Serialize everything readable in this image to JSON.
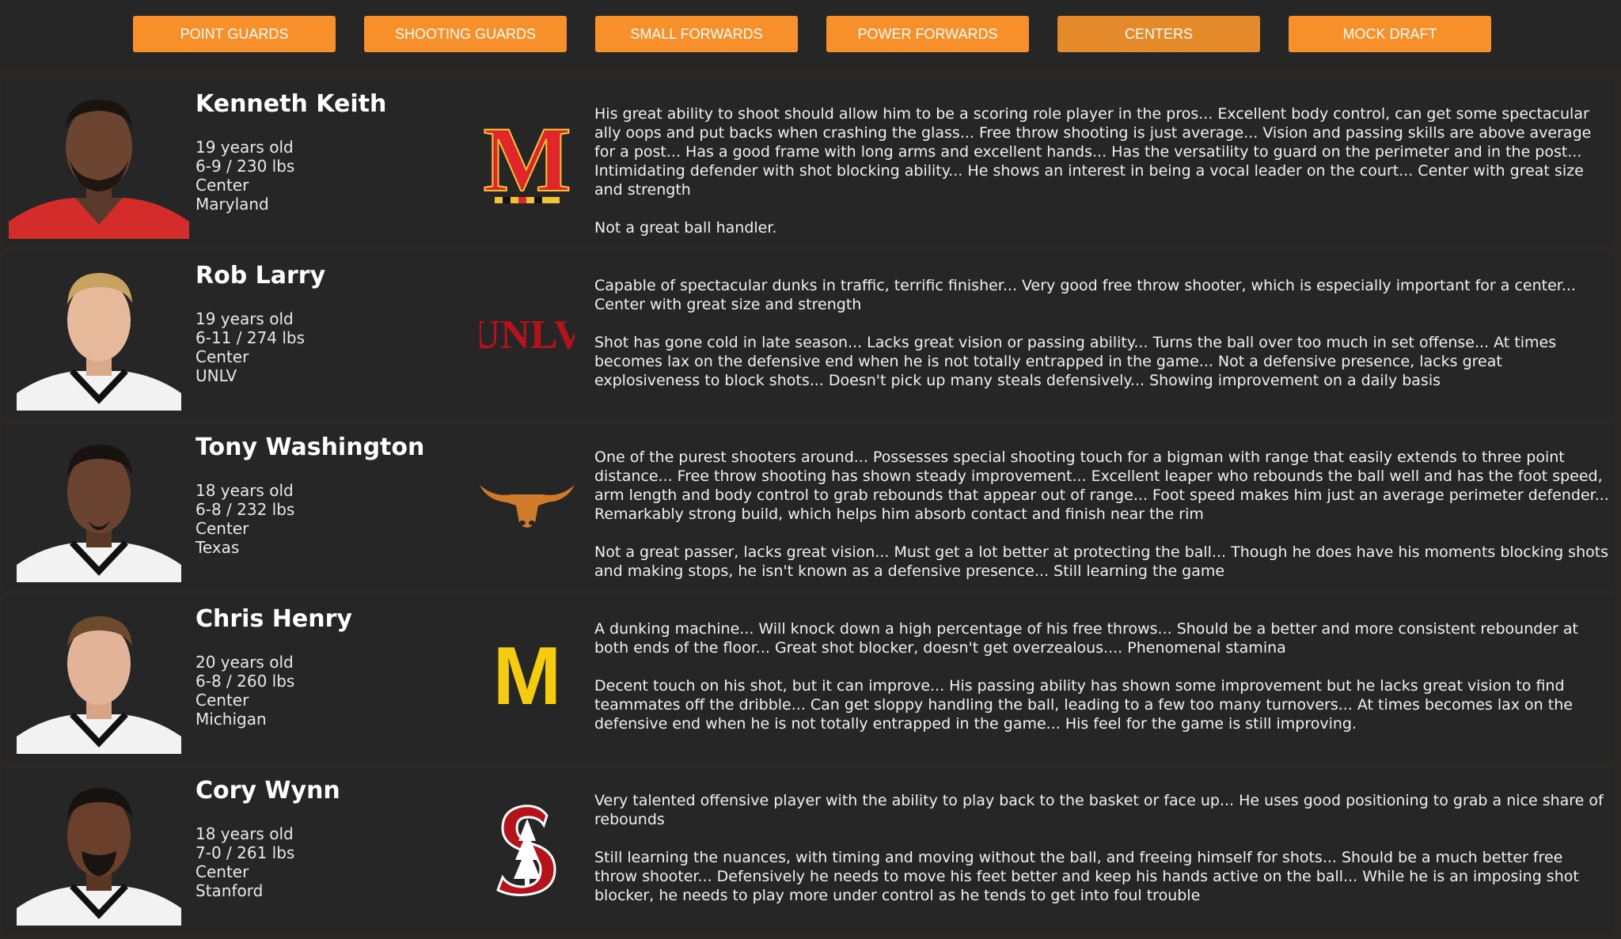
{
  "tabs": [
    {
      "label": "POINT GUARDS"
    },
    {
      "label": "SHOOTING GUARDS"
    },
    {
      "label": "SMALL FORWARDS"
    },
    {
      "label": "POWER FORWARDS"
    },
    {
      "label": "CENTERS"
    },
    {
      "label": "MOCK DRAFT"
    }
  ],
  "prospects": [
    {
      "name": "Kenneth Keith",
      "age": "19 years old",
      "size": "6-9 / 230 lbs",
      "position": "Center",
      "school": "Maryland",
      "logo_text": "M",
      "strengths": "His great ability to shoot should allow him to be a scoring role player in the pros... Excellent body control, can get some spectacular ally oops and put backs when crashing the glass... Free throw shooting is just average... Vision and passing skills are above average for a post... Has a good frame with long arms and excellent hands... Has the versatility to guard on the perimeter and in the post... Intimidating defender with shot blocking ability... He shows an interest in being a vocal leader on the court... Center with great size and strength",
      "weaknesses": "Not a great ball handler."
    },
    {
      "name": "Rob Larry",
      "age": "19 years old",
      "size": "6-11 / 274 lbs",
      "position": "Center",
      "school": "UNLV",
      "logo_text": "UNLV",
      "strengths": "Capable of spectacular dunks in traffic, terrific finisher... Very good free throw shooter, which is especially important for a center... Center with great size and strength",
      "weaknesses": "Shot has gone cold in late season... Lacks great vision or passing ability... Turns the ball over too much in set offense... At times becomes lax on the defensive end when he is not totally entrapped in the game... Not a defensive presence, lacks great explosiveness to block shots... Doesn't pick up many steals defensively... Showing improvement on a daily basis"
    },
    {
      "name": "Tony Washington",
      "age": "18 years old",
      "size": "6-8 / 232 lbs",
      "position": "Center",
      "school": "Texas",
      "logo_text": "",
      "strengths": "One of the purest shooters around... Possesses special shooting touch for a bigman with range that easily extends to three point distance... Free throw shooting has shown steady improvement... Excellent leaper who rebounds the ball well and has the foot speed, arm length and body control to grab rebounds that appear out of range... Foot speed makes him just an average perimeter defender... Remarkably strong build, which helps him absorb contact and finish near the rim",
      "weaknesses": "Not a great passer, lacks great vision... Must get a lot better at protecting the ball... Though he does have his moments blocking shots and making stops, he isn't known as a defensive presence... Still learning the game"
    },
    {
      "name": "Chris Henry",
      "age": "20 years old",
      "size": "6-8 / 260 lbs",
      "position": "Center",
      "school": "Michigan",
      "logo_text": "M",
      "strengths": "A dunking machine... Will knock down a high percentage of his free throws... Should be a better and more consistent rebounder at both ends of the floor... Great shot blocker, doesn't get overzealous.... Phenomenal stamina",
      "weaknesses": "Decent touch on his shot, but it can improve... His passing ability has shown some improvement but he lacks great vision to find teammates off the dribble... Can get sloppy handling the ball, leading to a few too many turnovers... At times becomes lax on the defensive end when he is not totally entrapped in the game... His feel for the game is still improving."
    },
    {
      "name": "Cory Wynn",
      "age": "18 years old",
      "size": "7-0 / 261 lbs",
      "position": "Center",
      "school": "Stanford",
      "logo_text": "",
      "strengths": "Very talented offensive player with the ability to play back to the basket or face up... He uses good positioning to grab a nice share of rebounds",
      "weaknesses": "Still learning the nuances, with timing and moving without the ball, and freeing himself for shots... Should be a much better free throw shooter... Defensively he needs to move his feet better and keep his hands active on the ball... While he is an imposing shot blocker, he needs to play more under control as he tends to get into foul trouble"
    }
  ]
}
